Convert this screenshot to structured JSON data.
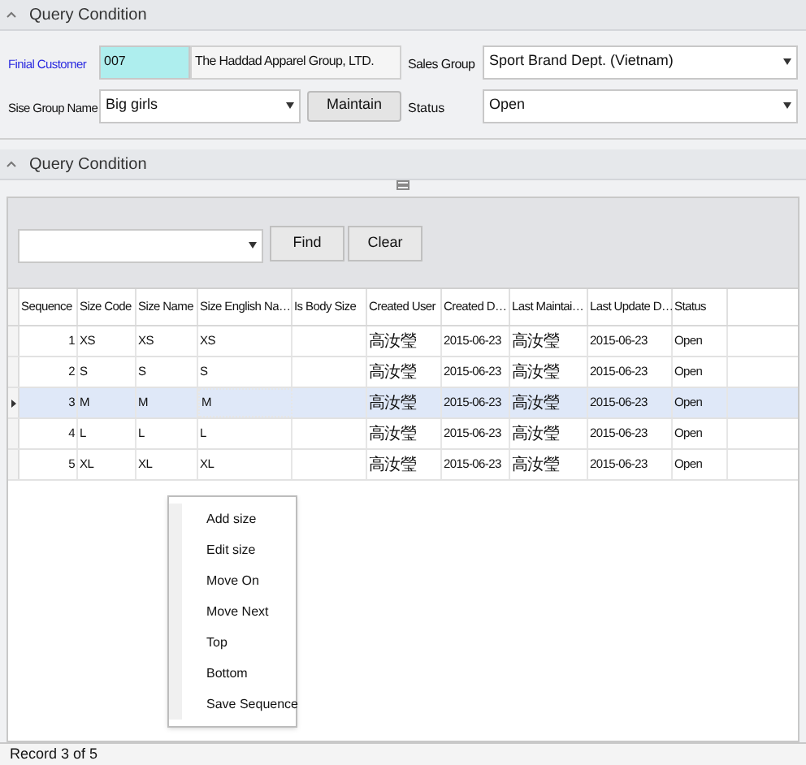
{
  "top_section": {
    "title": "Query Condition"
  },
  "form": {
    "customer_label": "Finial Customer",
    "customer_code": "007",
    "customer_name": "The Haddad Apparel Group, LTD.",
    "sales_group_label": "Sales Group",
    "sales_group": "Sport Brand Dept. (Vietnam)",
    "size_group_label": "Sise Group Name",
    "size_group": "Big girls",
    "maintain_button": "Maintain",
    "status_label": "Status",
    "status": "Open"
  },
  "bottom_section": {
    "title": "Query Condition",
    "find_button": "Find",
    "clear_button": "Clear"
  },
  "table": {
    "columns": [
      "Sequence",
      "Size Code",
      "Size Name",
      "Size English Na…",
      "Is Body Size",
      "Created User",
      "Created D…",
      "Last Maintai…",
      "Last Update D…",
      "Status"
    ],
    "rows": [
      {
        "selected": false,
        "cells": [
          "1",
          "XS",
          "XS",
          "XS",
          "",
          "高汝瑩",
          "2015-06-23",
          "高汝瑩",
          "2015-06-23",
          "Open"
        ]
      },
      {
        "selected": false,
        "cells": [
          "2",
          "S",
          "S",
          "S",
          "",
          "高汝瑩",
          "2015-06-23",
          "高汝瑩",
          "2015-06-23",
          "Open"
        ]
      },
      {
        "selected": true,
        "cells": [
          "3",
          "M",
          "M",
          "M",
          "",
          "高汝瑩",
          "2015-06-23",
          "高汝瑩",
          "2015-06-23",
          "Open"
        ]
      },
      {
        "selected": false,
        "cells": [
          "4",
          "L",
          "L",
          "L",
          "",
          "高汝瑩",
          "2015-06-23",
          "高汝瑩",
          "2015-06-23",
          "Open"
        ]
      },
      {
        "selected": false,
        "cells": [
          "5",
          "XL",
          "XL",
          "XL",
          "",
          "高汝瑩",
          "2015-06-23",
          "高汝瑩",
          "2015-06-23",
          "Open"
        ]
      }
    ]
  },
  "context_menu": {
    "items": [
      "Add size",
      "Edit size",
      "Move On",
      "Move Next",
      "Top",
      "Bottom",
      "Save Sequence"
    ]
  },
  "status_bar": "Record 3 of 5"
}
